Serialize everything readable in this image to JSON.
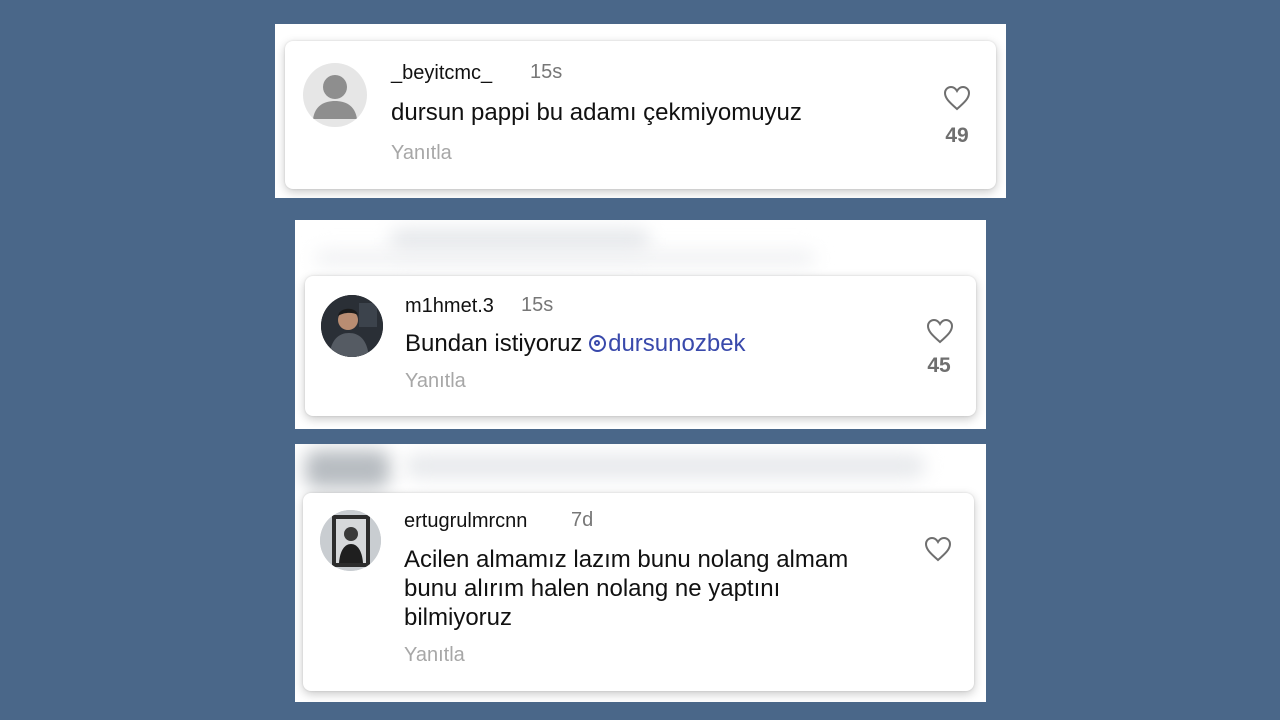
{
  "comments": [
    {
      "username": "_beyitcmc_",
      "time": "15s",
      "text": "dursun pappi bu adamı çekmiyomuyuz",
      "reply_label": "Yanıtla",
      "likes": "49",
      "avatar": "default-user-avatar"
    },
    {
      "username": "m1hmet.3",
      "time": "15s",
      "text": "Bundan istiyoruz ",
      "mention": "dursunozbek",
      "reply_label": "Yanıtla",
      "likes": "45",
      "avatar": "user-photo-avatar"
    },
    {
      "username": "ertugrulmrcnn",
      "time": "7d",
      "text_lines": [
        "Acilen almamız lazım bunu nolang almam",
        "bunu alırım halen nolang ne yaptını",
        "bilmiyoruz"
      ],
      "reply_label": "Yanıtla",
      "avatar": "user-photo-avatar"
    }
  ],
  "colors": {
    "background": "#4a6789",
    "mention": "#3949ab",
    "secondary_text": "#777777",
    "reply_text": "#a7a7a7"
  },
  "icons": [
    "heart-icon",
    "threads-mention-icon"
  ]
}
